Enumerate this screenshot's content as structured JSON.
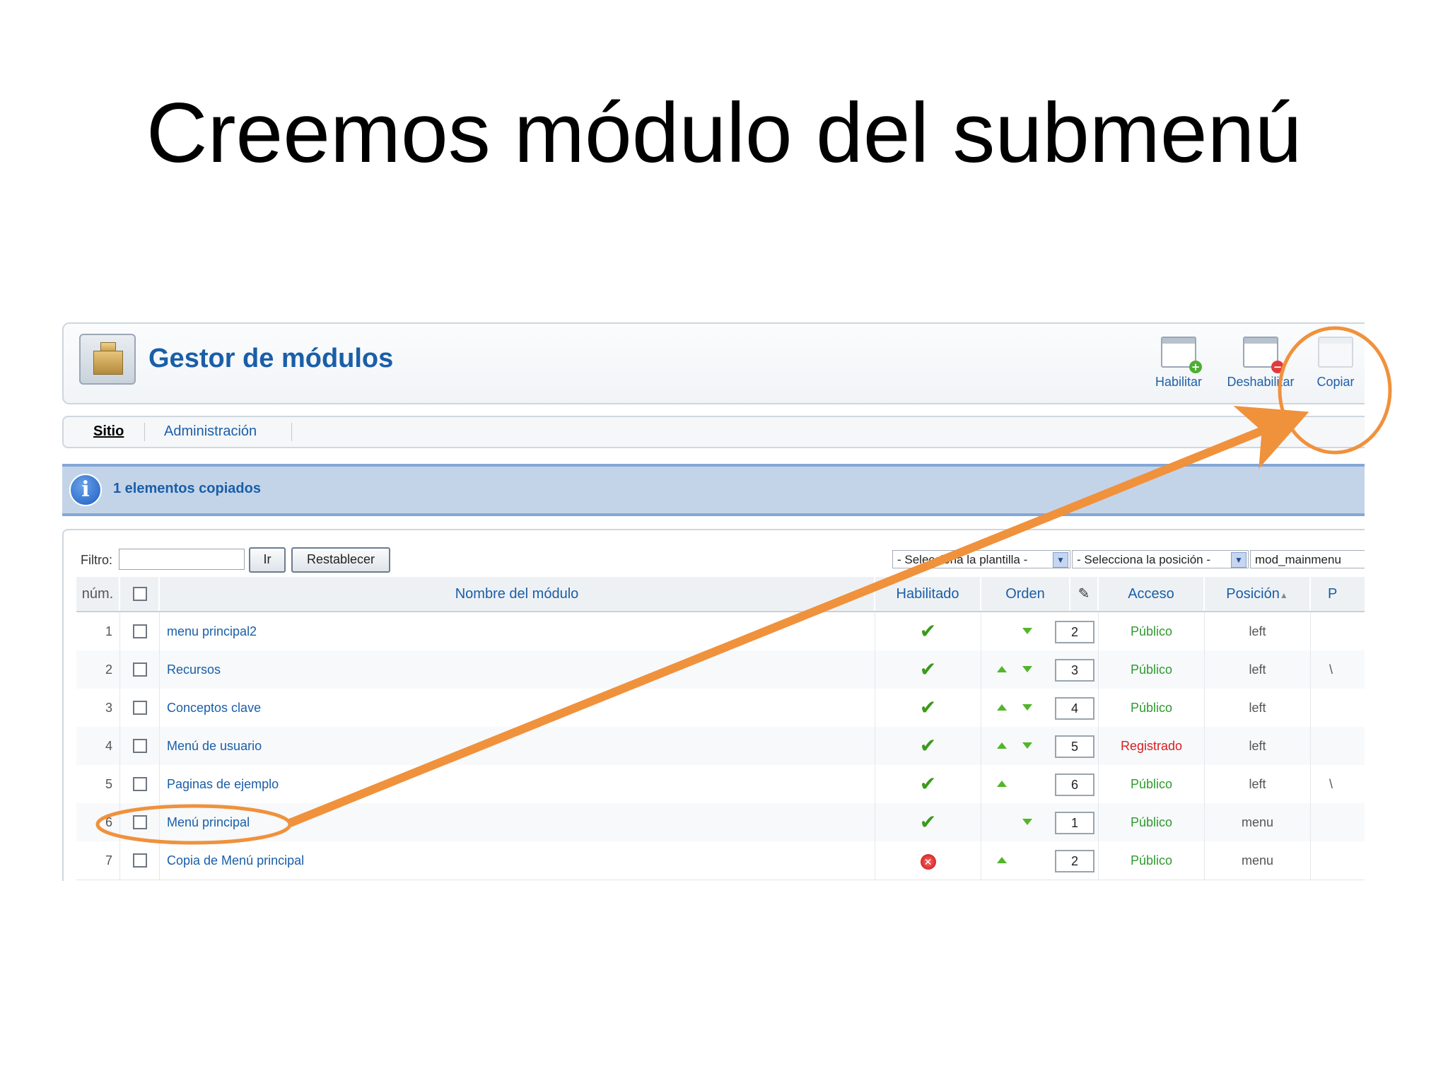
{
  "slide": {
    "title": "Creemos módulo del submenú"
  },
  "header": {
    "title": "Gestor de módulos"
  },
  "toolbar": [
    {
      "label": "Habilitar",
      "icon": "enable-icon"
    },
    {
      "label": "Deshabilitar",
      "icon": "disable-icon"
    },
    {
      "label": "Copiar",
      "icon": "copy-icon"
    }
  ],
  "submenu": {
    "tabs": [
      "Sitio",
      "Administración"
    ]
  },
  "message": {
    "text": "1 elementos copiados"
  },
  "filter": {
    "label": "Filtro:",
    "value": "",
    "go_label": "Ir",
    "reset_label": "Restablecer",
    "template_select": "- Selecciona la plantilla -",
    "position_select": "- Selecciona la posición -",
    "type_select": "mod_mainmenu"
  },
  "table": {
    "headers": [
      "núm.",
      "Nombre del módulo",
      "Habilitado",
      "Orden",
      "Acceso",
      "Posición",
      "P"
    ],
    "rows": [
      {
        "num": "1",
        "name": "menu principal2",
        "enabled": true,
        "order": "2",
        "access": "Público",
        "position": "left",
        "p": "",
        "up": false,
        "down": true
      },
      {
        "num": "2",
        "name": "Recursos",
        "enabled": true,
        "order": "3",
        "access": "Público",
        "position": "left",
        "p": "\\",
        "up": true,
        "down": true
      },
      {
        "num": "3",
        "name": "Conceptos clave",
        "enabled": true,
        "order": "4",
        "access": "Público",
        "position": "left",
        "p": "",
        "up": true,
        "down": true
      },
      {
        "num": "4",
        "name": "Menú de usuario",
        "enabled": true,
        "order": "5",
        "access": "Registrado",
        "position": "left",
        "p": "",
        "up": true,
        "down": true
      },
      {
        "num": "5",
        "name": "Paginas de ejemplo",
        "enabled": true,
        "order": "6",
        "access": "Público",
        "position": "left",
        "p": "\\",
        "up": true,
        "down": false
      },
      {
        "num": "6",
        "name": "Menú principal",
        "enabled": true,
        "order": "1",
        "access": "Público",
        "position": "menu",
        "p": "",
        "up": false,
        "down": true
      },
      {
        "num": "7",
        "name": "Copia de Menú principal",
        "enabled": false,
        "order": "2",
        "access": "Público",
        "position": "menu",
        "p": "",
        "up": true,
        "down": false
      }
    ]
  },
  "colors": {
    "accent": "#1a5ea8",
    "annotation": "#f0913c",
    "public": "#2e9a2e",
    "registered": "#d62020"
  }
}
